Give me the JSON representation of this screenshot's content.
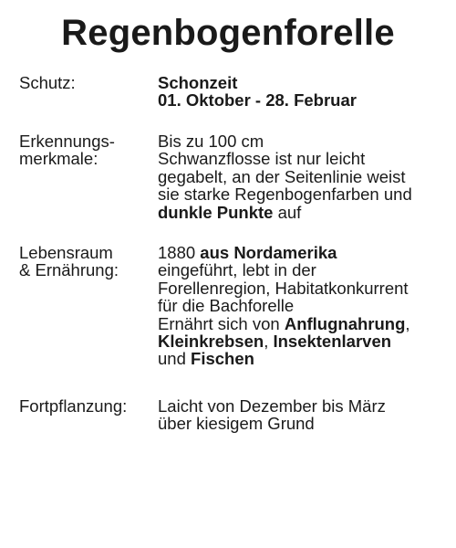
{
  "title": "Regenbogenforelle",
  "sections": {
    "schutz": {
      "label": "Schutz:",
      "lines": [
        [
          {
            "text": "Schonzeit",
            "bold": true
          }
        ],
        [
          {
            "text": "01. Oktober - 28. Februar",
            "bold": true
          }
        ]
      ]
    },
    "erkennungsmerkmale": {
      "label_lines": [
        "Erkennungs-",
        "merkmale:"
      ],
      "lines": [
        [
          {
            "text": "Bis zu 100 cm",
            "bold": false
          }
        ],
        [
          {
            "text": "Schwanzflosse ist nur leicht",
            "bold": false
          }
        ],
        [
          {
            "text": "gegabelt, an der Seitenlinie weist",
            "bold": false
          }
        ],
        [
          {
            "text": "sie starke Regenbogenfarben und",
            "bold": false
          }
        ],
        [
          {
            "text": "dunkle Punkte",
            "bold": true
          },
          {
            "text": " auf",
            "bold": false
          }
        ]
      ]
    },
    "lebensraum": {
      "label_lines": [
        "Lebensraum",
        "& Ernährung:"
      ],
      "lines": [
        [
          {
            "text": "1880 ",
            "bold": false
          },
          {
            "text": "aus Nordamerika",
            "bold": true
          }
        ],
        [
          {
            "text": "eingeführt, lebt in der",
            "bold": false
          }
        ],
        [
          {
            "text": "Forellenregion, Habitatkonkurrent",
            "bold": false
          }
        ],
        [
          {
            "text": "für die Bachforelle",
            "bold": false
          }
        ],
        [
          {
            "text": "Ernährt sich von ",
            "bold": false
          },
          {
            "text": "Anflugnahrung",
            "bold": true
          },
          {
            "text": ",",
            "bold": false
          }
        ],
        [
          {
            "text": "Kleinkrebsen",
            "bold": true
          },
          {
            "text": ", ",
            "bold": false
          },
          {
            "text": "Insektenlarven",
            "bold": true
          }
        ],
        [
          {
            "text": "und ",
            "bold": false
          },
          {
            "text": "Fischen",
            "bold": true
          }
        ]
      ]
    },
    "fortpflanzung": {
      "label": "Fortpflanzung:",
      "lines": [
        [
          {
            "text": "Laicht von Dezember bis März",
            "bold": false
          }
        ],
        [
          {
            "text": "über kiesigem Grund",
            "bold": false
          }
        ]
      ]
    }
  }
}
